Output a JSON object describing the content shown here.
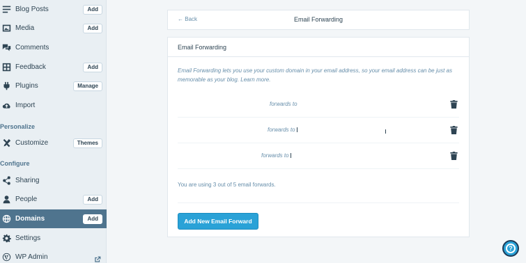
{
  "sidebar": {
    "items": [
      {
        "label": "Blog Posts",
        "badge": "Add",
        "icon": "blog-posts-icon"
      },
      {
        "label": "Media",
        "badge": "Add",
        "icon": "media-icon"
      },
      {
        "label": "Comments",
        "badge": "",
        "icon": "comments-icon"
      },
      {
        "label": "Feedback",
        "badge": "Add",
        "icon": "feedback-icon"
      },
      {
        "label": "Plugins",
        "badge": "Manage",
        "icon": "plugin-icon"
      },
      {
        "label": "Import",
        "badge": "",
        "icon": "import-icon"
      },
      {
        "label": "Customize",
        "badge": "Themes",
        "icon": "customize-icon"
      },
      {
        "label": "Sharing",
        "badge": "",
        "icon": "share-icon"
      },
      {
        "label": "People",
        "badge": "Add",
        "icon": "people-icon"
      },
      {
        "label": "Domains",
        "badge": "Add",
        "icon": "globe-icon"
      },
      {
        "label": "Settings",
        "badge": "",
        "icon": "gear-icon"
      },
      {
        "label": "WP Admin",
        "badge": "",
        "icon": "wordpress-icon"
      }
    ],
    "sections": {
      "personalize": "Personalize",
      "configure": "Configure"
    }
  },
  "header": {
    "back_label": "Back",
    "title": "Email Forwarding"
  },
  "section": {
    "title": "Email Forwarding",
    "description": "Email Forwarding lets you use your custom domain in your email address, so your email address can be just as memorable as your blog.",
    "learn_more": "Learn more."
  },
  "forwards": [
    {
      "text": "forwards to"
    },
    {
      "text": "forwards to"
    },
    {
      "text": "forwards to"
    }
  ],
  "usage_text": "You are using 3 out of 5 email forwards.",
  "add_button_label": "Add New Email Forward",
  "help_label": "?",
  "colors": {
    "accent": "#2aa2d7",
    "sidebar_active": "#4f748e",
    "sidebar_bg": "#e9eff3"
  }
}
